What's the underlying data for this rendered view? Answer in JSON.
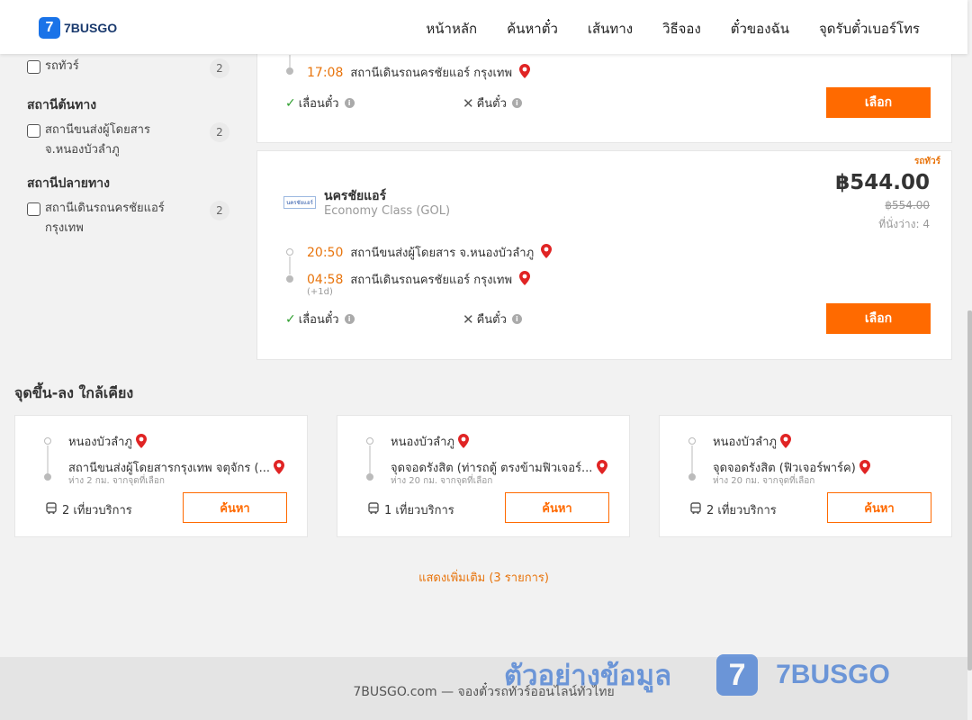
{
  "brand": {
    "name": "7BUSGO",
    "badge": "7"
  },
  "nav": [
    "หน้าหลัก",
    "ค้นหาตั๋ว",
    "เส้นทาง",
    "วิธีจอง",
    "ตั๋วของฉัน",
    "จุดรับตั๋วเบอร์โทร"
  ],
  "sidebar": {
    "tour": {
      "label": "รถทัวร์",
      "count": "2"
    },
    "origin_heading": "สถานีต้นทาง",
    "origin": {
      "label": "สถานีขนส่งผู้โดยสาร จ.หนองบัวลำภู",
      "count": "2"
    },
    "dest_heading": "สถานีปลายทาง",
    "dest": {
      "label": "สถานีเดินรถนครชัยแอร์ กรุงเทพ",
      "count": "2"
    }
  },
  "card1": {
    "arrive_time": "17:08",
    "arrive_station": "สถานีเดินรถนครชัยแอร์ กรุงเทพ",
    "reschedule": "เลื่อนตั๋ว",
    "refund": "คืนตั๋ว",
    "select": "เลือก"
  },
  "card2": {
    "tag": "รถทัวร์",
    "logo_text": "นครชัยแอร์",
    "operator": "นครชัยแอร์",
    "class": "Economy Class (GOL)",
    "price": "฿544.00",
    "old_price": "฿554.00",
    "seats": "ที่นั่งว่าง: 4",
    "depart_time": "20:50",
    "depart_station": "สถานีขนส่งผู้โดยสาร จ.หนองบัวลำภู",
    "arrive_time": "04:58",
    "arrive_station": "สถานีเดินรถนครชัยแอร์ กรุงเทพ",
    "next_day": "(+1d)",
    "reschedule": "เลื่อนตั๋ว",
    "refund": "คืนตั๋ว",
    "select": "เลือก"
  },
  "nearby": {
    "title": "จุดขึ้น-ลง ใกล้เคียง",
    "items": [
      {
        "from": "หนองบัวลำภู",
        "to": "สถานีขนส่งผู้โดยสารกรุงเทพ จตุจักร (...",
        "dist": "ห่าง 2 กม. จากจุดที่เลือก",
        "trips": "2 เที่ยวบริการ",
        "button": "ค้นหา"
      },
      {
        "from": "หนองบัวลำภู",
        "to": "จุดจอดรังสิต (ท่ารถตู้ ตรงข้ามฟิวเจอร์...",
        "dist": "ห่าง 20 กม. จากจุดที่เลือก",
        "trips": "1 เที่ยวบริการ",
        "button": "ค้นหา"
      },
      {
        "from": "หนองบัวลำภู",
        "to": "จุดจอดรังสิต (ฟิวเจอร์พาร์ค)",
        "dist": "ห่าง 20 กม. จากจุดที่เลือก",
        "trips": "2 เที่ยวบริการ",
        "button": "ค้นหา"
      }
    ],
    "show_more": "แสดงเพิ่มเติม (3 รายการ)"
  },
  "footer": {
    "text": "7BUSGO.com — จองตั๋วรถทัวร์ออนไลน์ทั่วไทย"
  },
  "watermark": {
    "thai": "ตัวอย่างข้อมูล",
    "badge": "7",
    "text": "7BUSGO"
  },
  "colors": {
    "accent": "#ff6a00",
    "brand": "#1a73e8",
    "time": "#e8740c",
    "pin": "#e02424"
  }
}
